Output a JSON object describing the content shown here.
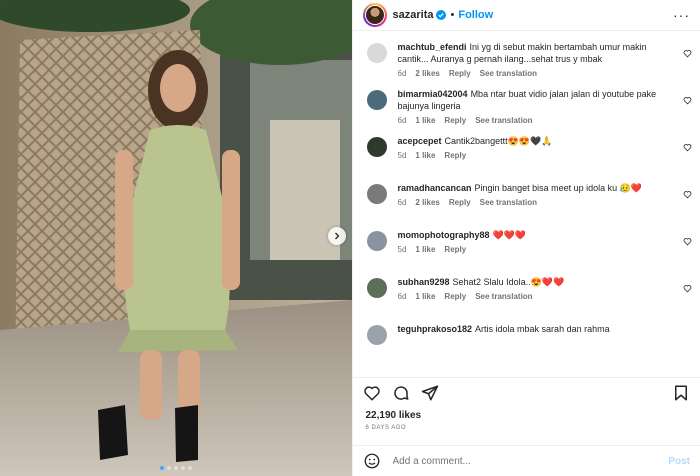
{
  "post": {
    "username": "sazarita",
    "follow_label": "Follow",
    "separator": "•",
    "more_label": "···",
    "likes": "22,190 likes",
    "date": "6 DAYS AGO",
    "add_comment_placeholder": "Add a comment...",
    "post_label": "Post",
    "image_alt": "Photo of a woman in a green floral mini dress and black platform sandals standing in a restaurant",
    "carousel_dots": 5,
    "carousel_active": 0
  },
  "comments": [
    {
      "user": "machtub_efendi",
      "text": "Ini yg di sebut makin bertambah umur makin cantik... Auranya g pernah ilang...sehat trus y mbak",
      "time": "6d",
      "likes": "2 likes",
      "reply": "Reply",
      "translate": "See translation",
      "avatar": "#d9d9d9"
    },
    {
      "user": "bimarmia042004",
      "text": "Mba ntar buat vidio jalan jalan di youtube pake bajunya lingeria",
      "time": "6d",
      "likes": "1 like",
      "reply": "Reply",
      "translate": "See translation",
      "avatar": "#4a6b7a"
    },
    {
      "user": "acepcepet",
      "text": "Cantik2bangettt😍😍🖤🙏",
      "time": "5d",
      "likes": "1 like",
      "reply": "Reply",
      "translate": "",
      "avatar": "#2f3a2c"
    },
    {
      "user": "ramadhancancan",
      "text": "Pingin banget bisa meet up idola ku 😥❤️",
      "time": "6d",
      "likes": "2 likes",
      "reply": "Reply",
      "translate": "See translation",
      "avatar": "#7a7a7a"
    },
    {
      "user": "momophotography88",
      "text": "❤️❤️❤️",
      "time": "5d",
      "likes": "1 like",
      "reply": "Reply",
      "translate": "",
      "avatar": "#8a93a0"
    },
    {
      "user": "subhan9298",
      "text": "Sehat2 Slalu Idola..😍❤️❤️",
      "time": "6d",
      "likes": "1 like",
      "reply": "Reply",
      "translate": "See translation",
      "avatar": "#5b6e58"
    },
    {
      "user": "teguhprakoso182",
      "text": "Artis idola mbak sarah dan rahma",
      "time": "",
      "likes": "",
      "reply": "",
      "translate": "",
      "avatar": "#9aa3ab"
    }
  ],
  "colors": {
    "accent": "#0095f6",
    "muted": "#737373",
    "text": "#262626",
    "post_disabled": "#b3dbff"
  }
}
